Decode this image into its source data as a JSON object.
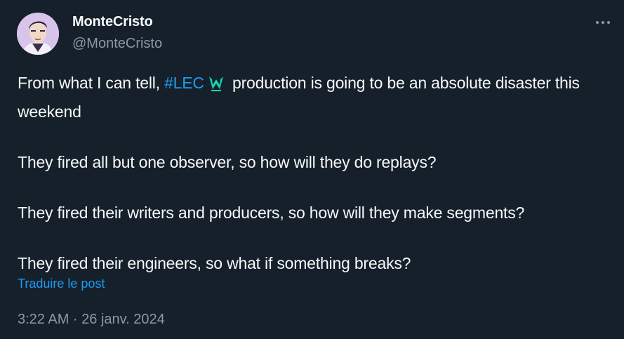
{
  "author": {
    "display_name": "MonteCristo",
    "handle": "@MonteCristo"
  },
  "icons": {
    "avatar": "avatar-illustration",
    "more": "more-horizontal-icon",
    "hashtag_emoji": "lec-logo-icon"
  },
  "tweet": {
    "line1_before": "From what I can tell, ",
    "hashtag": "#LEC",
    "line1_after": " production is going to be an absolute disaster this weekend",
    "para2": "They fired all but one observer, so how will they do replays?",
    "para3": "They fired their writers and producers, so how will they make segments?",
    "para4": "They fired their engineers, so what if something breaks?"
  },
  "translate_label": "Traduire le post",
  "timestamp": "3:22 AM · 26 janv. 2024",
  "colors": {
    "background": "#15202b",
    "text": "#f7f9f9",
    "secondary": "#8b98a5",
    "link": "#1d9bf0",
    "lec_accent": "#13d8b0"
  }
}
